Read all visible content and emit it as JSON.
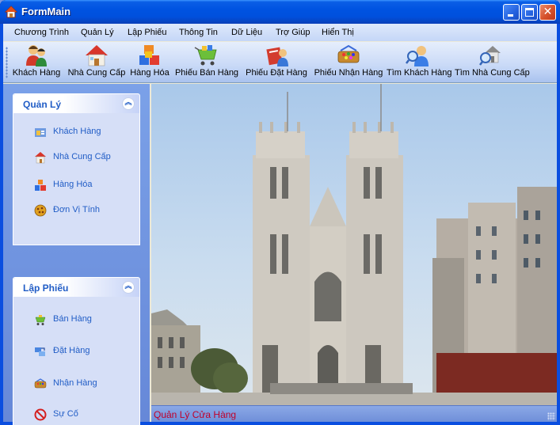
{
  "window": {
    "title": "FormMain"
  },
  "menu": [
    "Chương Trình",
    "Quản Lý",
    "Lập Phiếu",
    "Thông Tin",
    "Dữ Liệu",
    "Trợ Giúp",
    "Hiển Thị"
  ],
  "toolbar": [
    {
      "label": "Khách Hàng",
      "icon": "customers-icon"
    },
    {
      "label": "Nhà Cung Cấp",
      "icon": "house-icon"
    },
    {
      "label": "Hàng Hóa",
      "icon": "cubes-icon"
    },
    {
      "label": "Phiếu Bán Hàng",
      "icon": "cart-icon"
    },
    {
      "label": "Phiếu Đặt Hàng",
      "icon": "order-pen-icon"
    },
    {
      "label": "Phiếu Nhận Hàng",
      "icon": "receive-box-icon"
    },
    {
      "label": "Tìm Khách Hàng",
      "icon": "search-user-icon"
    },
    {
      "label": "Tìm Nhà Cung Cấp",
      "icon": "search-house-icon"
    }
  ],
  "sidebar": {
    "groups": [
      {
        "title": "Quản Lý",
        "items": [
          {
            "label": "Khách Hàng",
            "icon": "customer-icon"
          },
          {
            "label": "Nhà Cung Cấp",
            "icon": "supplier-icon"
          },
          {
            "label": "Hàng Hóa",
            "icon": "goods-icon"
          },
          {
            "label": "Đơn Vị Tính",
            "icon": "unit-icon"
          }
        ]
      },
      {
        "title": "Lập Phiếu",
        "items": [
          {
            "label": "Bán Hàng",
            "icon": "sale-cart-icon"
          },
          {
            "label": "Đặt Hàng",
            "icon": "order-icon"
          },
          {
            "label": "Nhận Hàng",
            "icon": "receive-icon"
          },
          {
            "label": "Sự Cố",
            "icon": "no-entry-icon"
          }
        ]
      }
    ]
  },
  "status": {
    "text": "Quản Lý Cửa Hàng"
  },
  "colors": {
    "titlebar": "#0053e1",
    "group_title": "#215dc6",
    "status_text": "#c0002a",
    "panel_bg": "#6f90dc"
  }
}
